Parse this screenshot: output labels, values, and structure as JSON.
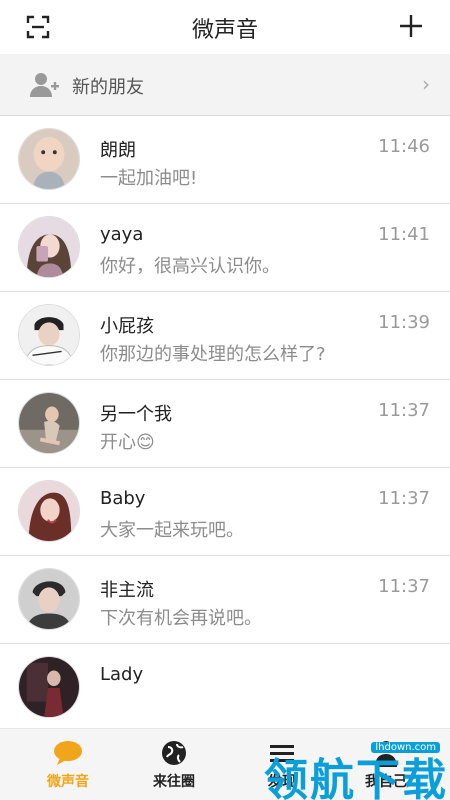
{
  "header": {
    "title": "微声音",
    "scan_icon": "scan-icon",
    "add_icon": "plus-icon"
  },
  "new_friends": {
    "label": "新的朋友",
    "chevron": "›",
    "icon": "add-user-icon"
  },
  "chats": [
    {
      "name": "朗朗",
      "time": "11:46",
      "message": "一起加油吧!"
    },
    {
      "name": "yaya",
      "time": "11:41",
      "message": "你好，很高兴认识你。"
    },
    {
      "name": "小屁孩",
      "time": "11:39",
      "message": "你那边的事处理的怎么样了?"
    },
    {
      "name": "另一个我",
      "time": "11:37",
      "message": "开心😊"
    },
    {
      "name": "Baby",
      "time": "11:37",
      "message": "大家一起来玩吧。"
    },
    {
      "name": "非主流",
      "time": "11:37",
      "message": "下次有机会再说吧。"
    },
    {
      "name": "Lady",
      "time": "",
      "message": ""
    }
  ],
  "tabs": [
    {
      "label": "微声音",
      "icon": "chat-bubble-icon",
      "active": true
    },
    {
      "label": "来往圈",
      "icon": "globe-icon",
      "active": false
    },
    {
      "label": "发现",
      "icon": "discover-icon",
      "active": false
    },
    {
      "label": "我自己",
      "icon": "person-icon",
      "active": false
    }
  ],
  "watermark": {
    "text": "领航下载",
    "url": "lhdown.com"
  },
  "colors": {
    "accent": "#f2a51a",
    "watermark": "#0a9fd8",
    "divider": "#e6dced"
  }
}
